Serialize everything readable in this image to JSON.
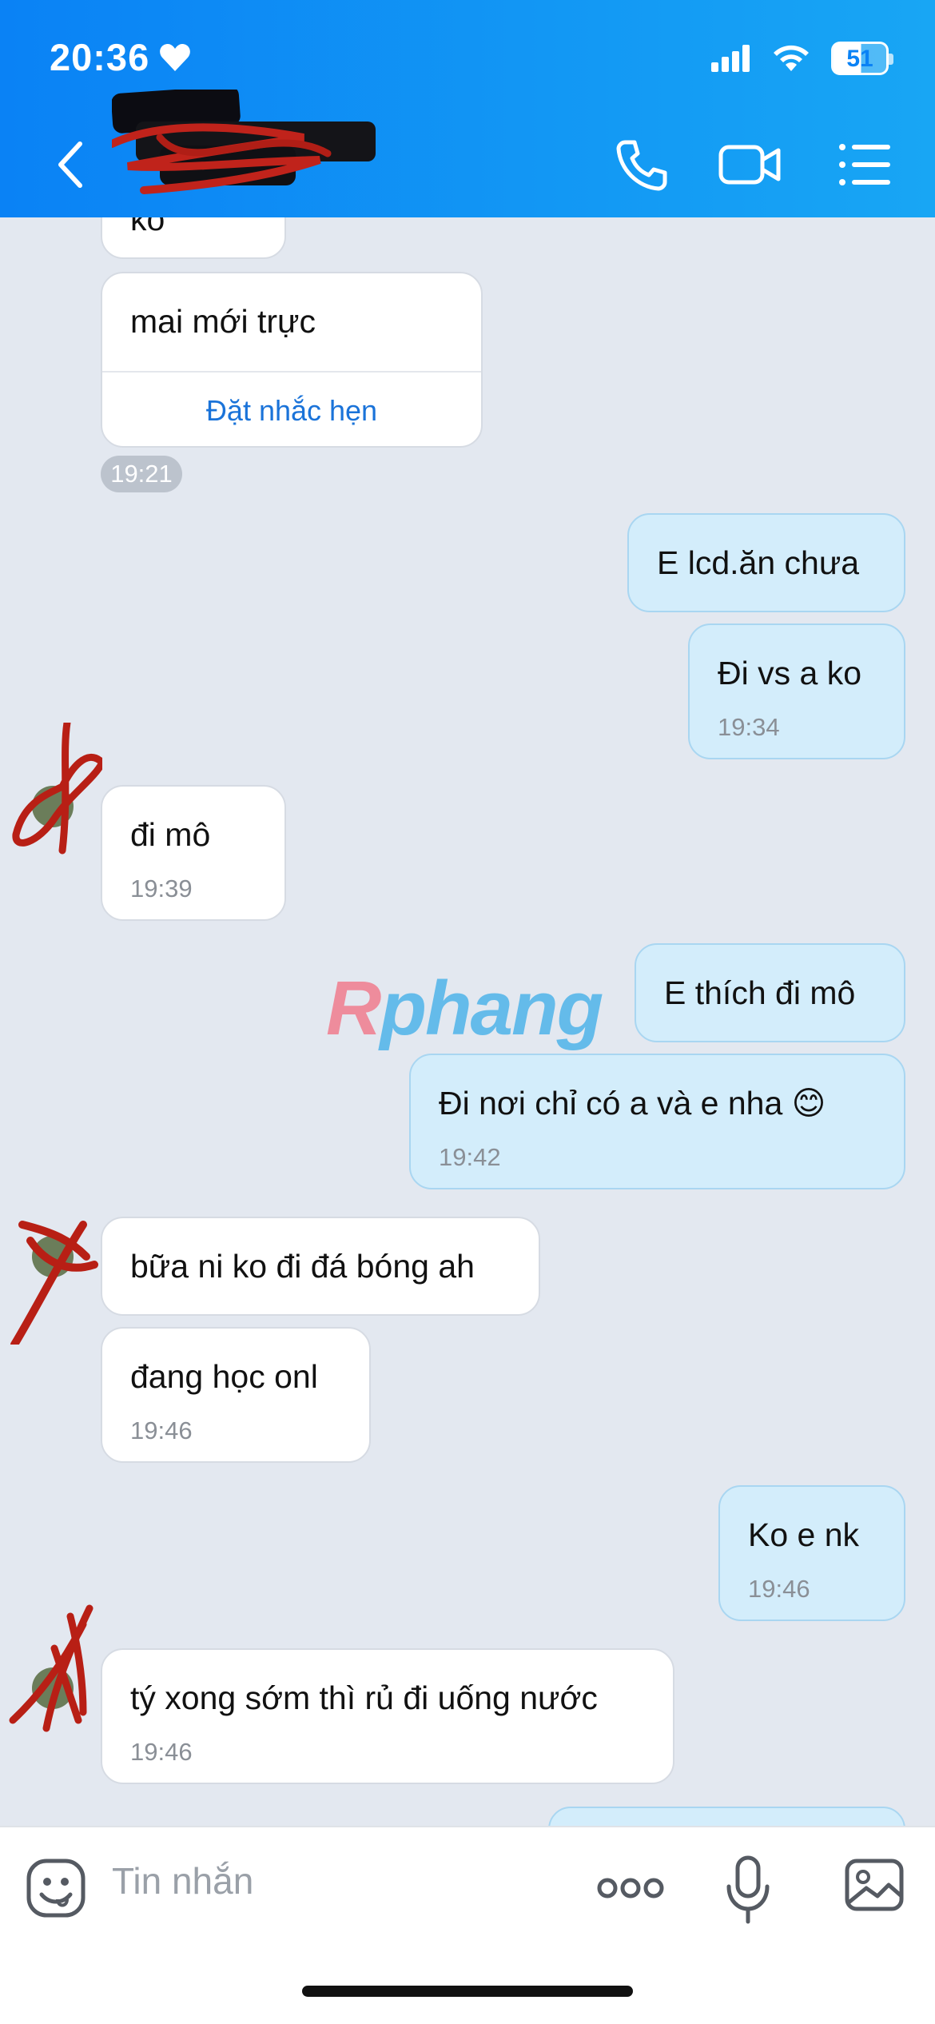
{
  "status": {
    "time": "20:36",
    "battery": "51"
  },
  "header": {
    "contact_name": ""
  },
  "watermark": {
    "part1": "R",
    "part2": "phang"
  },
  "messages": {
    "m0": {
      "text": "ko"
    },
    "m1": {
      "text": "mai mới trực",
      "action": "Đặt nhắc hẹn",
      "time": "19:21"
    },
    "m2": {
      "text": "E lcd.ăn chưa"
    },
    "m3": {
      "text": "Đi vs a ko",
      "time": "19:34"
    },
    "m4": {
      "text": "đi mô",
      "time": "19:39"
    },
    "m5": {
      "text": "E thích đi mô"
    },
    "m6": {
      "text": "Đi nơi chỉ có a và e nha 😊",
      "time": "19:42"
    },
    "m7": {
      "text": "bữa ni ko đi đá bóng ah"
    },
    "m8": {
      "text": "đang học onl",
      "time": "19:46"
    },
    "m9": {
      "text": "Ko e nk",
      "time": "19:46"
    },
    "m10": {
      "text": "tý xong sớm thì rủ đi uống nước",
      "time": "19:46"
    }
  },
  "composer": {
    "placeholder": "Tin nhắn"
  },
  "icons": [
    "heart-icon",
    "signal-icon",
    "wifi-icon",
    "battery-icon",
    "back-icon",
    "phone-icon",
    "video-call-icon",
    "menu-list-icon",
    "sticker-icon",
    "more-icon",
    "microphone-icon",
    "image-icon"
  ],
  "colors": {
    "header_start": "#0a82f5",
    "header_end": "#18a6f4",
    "outgoing_bubble": "#d3edfb",
    "incoming_bubble": "#ffffff",
    "chat_bg": "#e3e8f0",
    "link": "#1a73d9"
  }
}
